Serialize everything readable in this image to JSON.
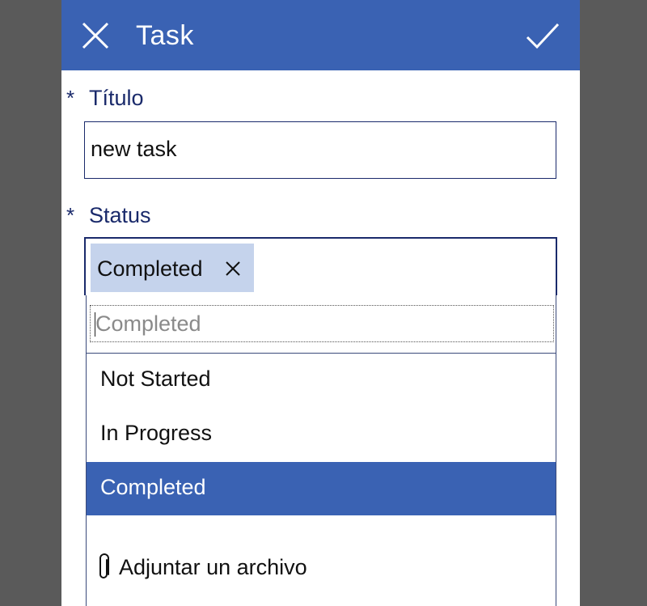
{
  "header": {
    "title": "Task",
    "close_icon": "close-icon",
    "confirm_icon": "checkmark-icon",
    "background": "#3a62b3"
  },
  "form": {
    "required_marker": "*",
    "titulo": {
      "label": "Título",
      "value": "new task"
    },
    "status": {
      "label": "Status",
      "selected_chip": "Completed",
      "search_placeholder": "Completed",
      "options": [
        {
          "label": "Not Started",
          "selected": false
        },
        {
          "label": "In Progress",
          "selected": false
        },
        {
          "label": "Completed",
          "selected": true
        }
      ]
    },
    "attachment": {
      "label": "Adjuntar un archivo",
      "icon": "paperclip-icon"
    }
  },
  "colors": {
    "accent": "#3a62b3",
    "chip": "#c5d3ec",
    "label": "#1a2a6b"
  }
}
